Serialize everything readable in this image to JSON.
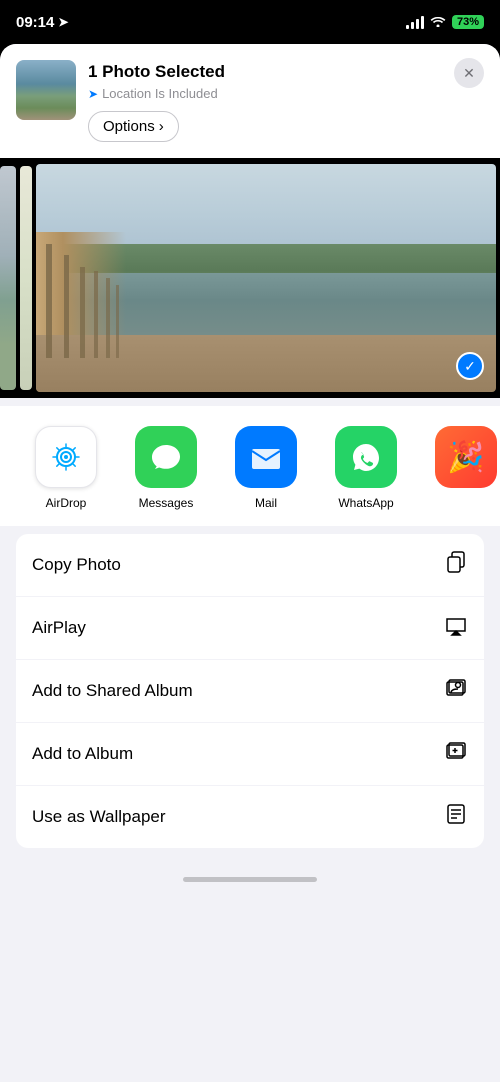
{
  "statusBar": {
    "time": "09:14",
    "battery": "73%"
  },
  "shareHeader": {
    "title": "1 Photo Selected",
    "subtitle": "Location Is Included",
    "optionsLabel": "Options",
    "optionsChevron": "›"
  },
  "photoStrip": {
    "checkmark": "✓"
  },
  "appRow": {
    "apps": [
      {
        "id": "airdrop",
        "label": "AirDrop"
      },
      {
        "id": "messages",
        "label": "Messages"
      },
      {
        "id": "mail",
        "label": "Mail"
      },
      {
        "id": "whatsapp",
        "label": "WhatsApp"
      }
    ]
  },
  "actionList": {
    "items": [
      {
        "id": "copy-photo",
        "label": "Copy Photo"
      },
      {
        "id": "airplay",
        "label": "AirPlay"
      },
      {
        "id": "add-shared-album",
        "label": "Add to Shared Album"
      },
      {
        "id": "add-album",
        "label": "Add to Album"
      },
      {
        "id": "use-wallpaper",
        "label": "Use as Wallpaper"
      }
    ]
  }
}
